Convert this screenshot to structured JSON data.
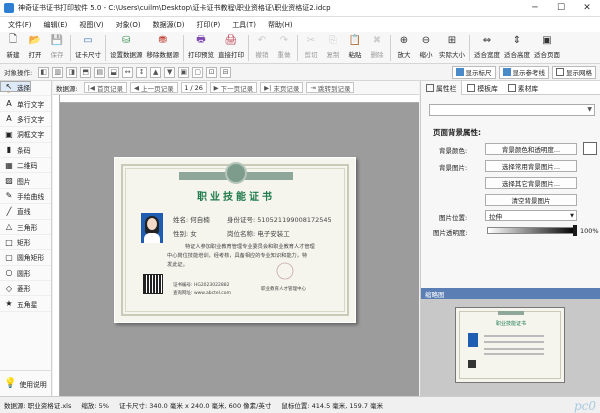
{
  "window": {
    "title": "神奇证书证书打印软件 5.0 - C:\\Users\\cuilm\\Desktop\\证卡证书教程\\职业资格证\\职业资格证2.idcp",
    "min": "─",
    "max": "☐",
    "close": "✕"
  },
  "menu": [
    "文件(F)",
    "编辑(E)",
    "视图(V)",
    "对象(O)",
    "数据源(D)",
    "打印(P)",
    "工具(T)",
    "帮助(H)"
  ],
  "toolbar": [
    {
      "label": "新建",
      "icon": "new-file-icon",
      "dim": false
    },
    {
      "label": "打开",
      "icon": "open-folder-icon",
      "dim": false
    },
    {
      "label": "保存",
      "icon": "save-icon",
      "dim": true
    },
    {
      "label": "证卡尺寸",
      "icon": "card-size-icon",
      "dim": false
    },
    {
      "label": "设置数据源",
      "icon": "set-datasource-icon",
      "dim": false
    },
    {
      "label": "移除数据源",
      "icon": "remove-datasource-icon",
      "dim": false
    },
    {
      "label": "打印预览",
      "icon": "print-preview-icon",
      "dim": false
    },
    {
      "label": "直接打印",
      "icon": "direct-print-icon",
      "dim": false
    },
    {
      "label": "撤销",
      "icon": "undo-icon",
      "dim": true
    },
    {
      "label": "重做",
      "icon": "redo-icon",
      "dim": true
    },
    {
      "label": "剪切",
      "icon": "cut-icon",
      "dim": true
    },
    {
      "label": "复制",
      "icon": "copy-icon",
      "dim": true
    },
    {
      "label": "粘贴",
      "icon": "paste-icon",
      "dim": false
    },
    {
      "label": "删除",
      "icon": "delete-icon",
      "dim": true
    },
    {
      "label": "放大",
      "icon": "zoom-in-icon",
      "dim": false
    },
    {
      "label": "缩小",
      "icon": "zoom-out-icon",
      "dim": false
    },
    {
      "label": "实际大小",
      "icon": "actual-size-icon",
      "dim": false
    },
    {
      "label": "适合宽度",
      "icon": "fit-width-icon",
      "dim": false
    },
    {
      "label": "适合高度",
      "icon": "fit-height-icon",
      "dim": false
    },
    {
      "label": "适合页面",
      "icon": "fit-page-icon",
      "dim": false
    }
  ],
  "toolbar2": {
    "label": "对象操作:",
    "view_buttons": [
      "显示标尺",
      "显示参考线",
      "显示网格"
    ]
  },
  "left_tools": [
    {
      "label": "选择",
      "icon": "arrow-select-icon",
      "glyph": "↖",
      "selected": true,
      "dim": false
    },
    {
      "label": "漫游",
      "icon": "pan-hand-icon",
      "glyph": "✋",
      "selected": false,
      "dim": true
    },
    {
      "label": "单行文字",
      "icon": "single-text-icon",
      "glyph": "A",
      "selected": false,
      "dim": false
    },
    {
      "label": "多行文字",
      "icon": "multi-text-icon",
      "glyph": "A",
      "selected": false,
      "dim": false
    },
    {
      "label": "洞框文字",
      "icon": "frame-text-icon",
      "glyph": "▣",
      "selected": false,
      "dim": false
    },
    {
      "label": "条码",
      "icon": "barcode-icon",
      "glyph": "▮",
      "selected": false,
      "dim": false
    },
    {
      "label": "二维码",
      "icon": "qrcode-icon",
      "glyph": "▦",
      "selected": false,
      "dim": false
    },
    {
      "label": "图片",
      "icon": "image-icon",
      "glyph": "▨",
      "selected": false,
      "dim": false
    },
    {
      "label": "手绘曲线",
      "icon": "freehand-icon",
      "glyph": "✎",
      "selected": false,
      "dim": false
    },
    {
      "label": "直线",
      "icon": "line-icon",
      "glyph": "╱",
      "selected": false,
      "dim": false
    },
    {
      "label": "三角形",
      "icon": "triangle-icon",
      "glyph": "△",
      "selected": false,
      "dim": false
    },
    {
      "label": "矩形",
      "icon": "rectangle-icon",
      "glyph": "□",
      "selected": false,
      "dim": false
    },
    {
      "label": "圆角矩形",
      "icon": "rounded-rect-icon",
      "glyph": "▢",
      "selected": false,
      "dim": false
    },
    {
      "label": "圆形",
      "icon": "circle-icon",
      "glyph": "○",
      "selected": false,
      "dim": false
    },
    {
      "label": "菱形",
      "icon": "diamond-icon",
      "glyph": "◇",
      "selected": false,
      "dim": false
    },
    {
      "label": "五角星",
      "icon": "star-icon",
      "glyph": "★",
      "selected": false,
      "dim": false
    }
  ],
  "help": "使用说明",
  "nav": {
    "datasource": "数据源:",
    "first": "首页记录",
    "prev": "上一页记录",
    "page": "1 / 26",
    "next": "下一页记录",
    "last": "末页记录",
    "jump": "跳转到记录"
  },
  "cert": {
    "title": "职业技能证书",
    "name": "姓名: 何自楠",
    "id": "身份证号: 51052119900817254​5",
    "gender": "性别: 女",
    "position": "岗位名称: 电子安装工",
    "body1": "特证人参加职业教育管理专业委员会和职业教育人才管理",
    "body2": "中心岗位技能培训，经考核，具备相应的专业知识和能力，特",
    "body3": "发此证。",
    "cert_no": "证书编号: HG2023022882",
    "query": "查询网址: www.abctel.com",
    "issuer": "职业教育人才管理中心"
  },
  "right": {
    "tabs": [
      "属性栏",
      "模板库",
      "素材库"
    ],
    "section": "页面背景属性:",
    "bg_color_label": "背景颜色:",
    "bg_color_btn": "背景颜色和透明度...",
    "bg_image_label": "背景图片:",
    "choose_common": "选择常用背景图片...",
    "choose_other": "选择其它背景图片...",
    "clear": "清空背景图片",
    "position_label": "图片位置:",
    "position_value": "拉伸",
    "alpha_label": "图片透明度:",
    "alpha_value": "100%",
    "thumb_title": "缩略图",
    "thumb_cert_title": "职业技能证书"
  },
  "status": {
    "datasource": "数据源: 职业资格证.xls",
    "zoom": "缩放: 5%",
    "size": "证卡尺寸: 340.0 毫米 x 240.0 毫米, 600 像素/英寸",
    "coords": "鼠标位置: 414.5 毫米, 159.7 毫米"
  },
  "watermark": "pc0"
}
